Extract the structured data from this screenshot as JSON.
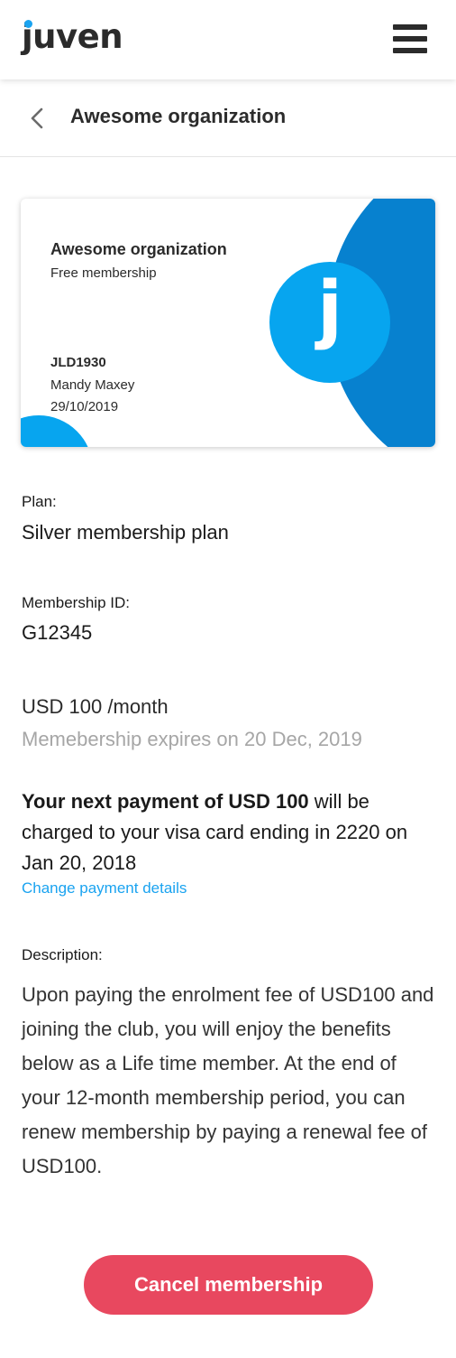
{
  "header": {
    "logo_text": "juven",
    "menu_icon": "hamburger-menu-icon"
  },
  "subheader": {
    "back_icon": "chevron-left-icon",
    "title": "Awesome organization"
  },
  "card": {
    "organization": "Awesome organization",
    "membership_type": "Free membership",
    "logo_letter": "j",
    "code": "JLD1930",
    "member_name": "Mandy Maxey",
    "date": "29/10/2019",
    "colors": {
      "dark_blue": "#0781cf",
      "light_blue": "#07a5ef"
    }
  },
  "plan": {
    "label": "Plan:",
    "value": "Silver membership plan"
  },
  "membership_id": {
    "label": "Membership ID:",
    "value": "G12345"
  },
  "pricing": {
    "price": "USD 100 /month",
    "expires": "Memebership expires on 20 Dec, 2019"
  },
  "payment": {
    "bold_text": "Your next payment of USD 100",
    "text": " will be charged to your visa card ending in 2220 on Jan 20, 2018",
    "change_link": "Change payment details"
  },
  "description": {
    "label": "Description:",
    "text": "Upon paying the enrolment fee of USD100 and joining the club, you will enjoy the benefits below as a Life time member. At the end of your 12-month membership period, you can renew membership by paying a renewal fee of USD100."
  },
  "actions": {
    "cancel_label": "Cancel membership",
    "cancel_color": "#e8485f"
  }
}
